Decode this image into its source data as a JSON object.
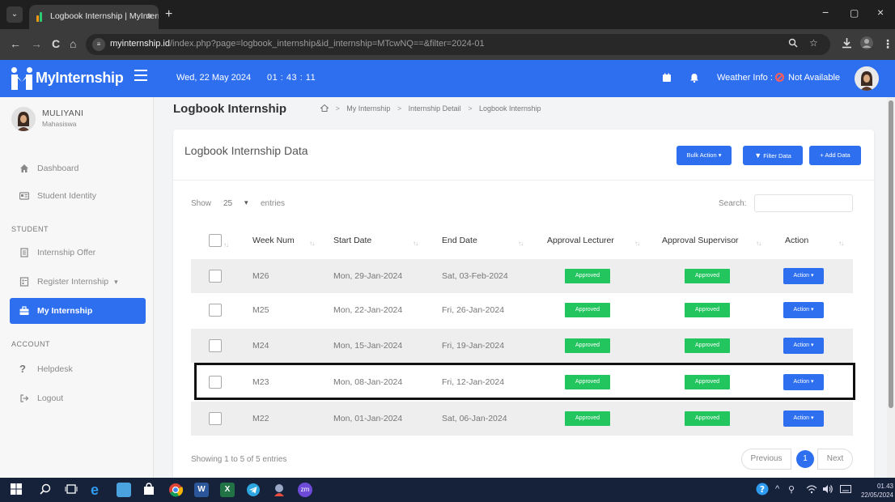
{
  "browser": {
    "tab_title": "Logbook Internship | MyIntern",
    "tab_close": "×",
    "new_tab": "+",
    "url_domain": "myinternship.id",
    "url_path": "/index.php?page=logbook_internship&id_internship=MTcwNQ==&filter=2024-01",
    "back": "←",
    "forward": "→",
    "reload": "C",
    "home": "⌂",
    "minimize": "−",
    "maximize": "▢",
    "close": "×"
  },
  "app": {
    "brand": "MyInternship",
    "date": "Wed, 22 May 2024",
    "time": "01 : 43 : 11",
    "weather_label": "Weather Info :",
    "weather_value": "Not Available"
  },
  "sidebar": {
    "user_name": "MULIYANI",
    "user_role": "Mahasiswa",
    "items": [
      {
        "label": "Dashboard"
      },
      {
        "label": "Student Identity"
      }
    ],
    "section_student": "STUDENT",
    "student_items": [
      {
        "label": "Internship Offer"
      },
      {
        "label": "Register Internship"
      },
      {
        "label": "My Internship"
      }
    ],
    "register_chevron": "▾",
    "section_account": "ACCOUNT",
    "account_items": [
      {
        "label": "Helpdesk"
      },
      {
        "label": "Logout"
      }
    ]
  },
  "page": {
    "title": "Logbook Internship",
    "breadcrumb": [
      "My Internship",
      "Internship Detail",
      "Logbook Internship"
    ],
    "breadcrumb_sep": ">"
  },
  "card": {
    "title": "Logbook Internship Data",
    "bulk_action": "Bulk Action",
    "filter": "Filter Data",
    "add": "+ Add Data",
    "show_label": "Show",
    "show_value": "25",
    "show_chevron": "▾",
    "entries_label": "entries",
    "search_label": "Search:",
    "search_value": ""
  },
  "table": {
    "columns": [
      "Week Num",
      "Start Date",
      "End Date",
      "Approval Lecturer",
      "Approval Supervisor",
      "Action"
    ],
    "sort_glyph": "↑↓",
    "rows": [
      {
        "week": "M26",
        "start": "Mon, 29-Jan-2024",
        "end": "Sat, 03-Feb-2024",
        "lecturer": "Approved",
        "supervisor": "Approved",
        "action": "Action"
      },
      {
        "week": "M25",
        "start": "Mon, 22-Jan-2024",
        "end": "Fri, 26-Jan-2024",
        "lecturer": "Approved",
        "supervisor": "Approved",
        "action": "Action"
      },
      {
        "week": "M24",
        "start": "Mon, 15-Jan-2024",
        "end": "Fri, 19-Jan-2024",
        "lecturer": "Approved",
        "supervisor": "Approved",
        "action": "Action"
      },
      {
        "week": "M23",
        "start": "Mon, 08-Jan-2024",
        "end": "Fri, 12-Jan-2024",
        "lecturer": "Approved",
        "supervisor": "Approved",
        "action": "Action"
      },
      {
        "week": "M22",
        "start": "Mon, 01-Jan-2024",
        "end": "Sat, 06-Jan-2024",
        "lecturer": "Approved",
        "supervisor": "Approved",
        "action": "Action"
      }
    ],
    "showing": "Showing 1 to 5 of 5 entries",
    "prev": "Previous",
    "page": "1",
    "next": "Next"
  },
  "taskbar": {
    "clock_time": "01.43",
    "clock_date": "22/05/2024",
    "ai_label": "zm"
  },
  "colors": {
    "primary": "#2e6ff0",
    "approved": "#22c55e",
    "highlight_border": "#111111"
  }
}
